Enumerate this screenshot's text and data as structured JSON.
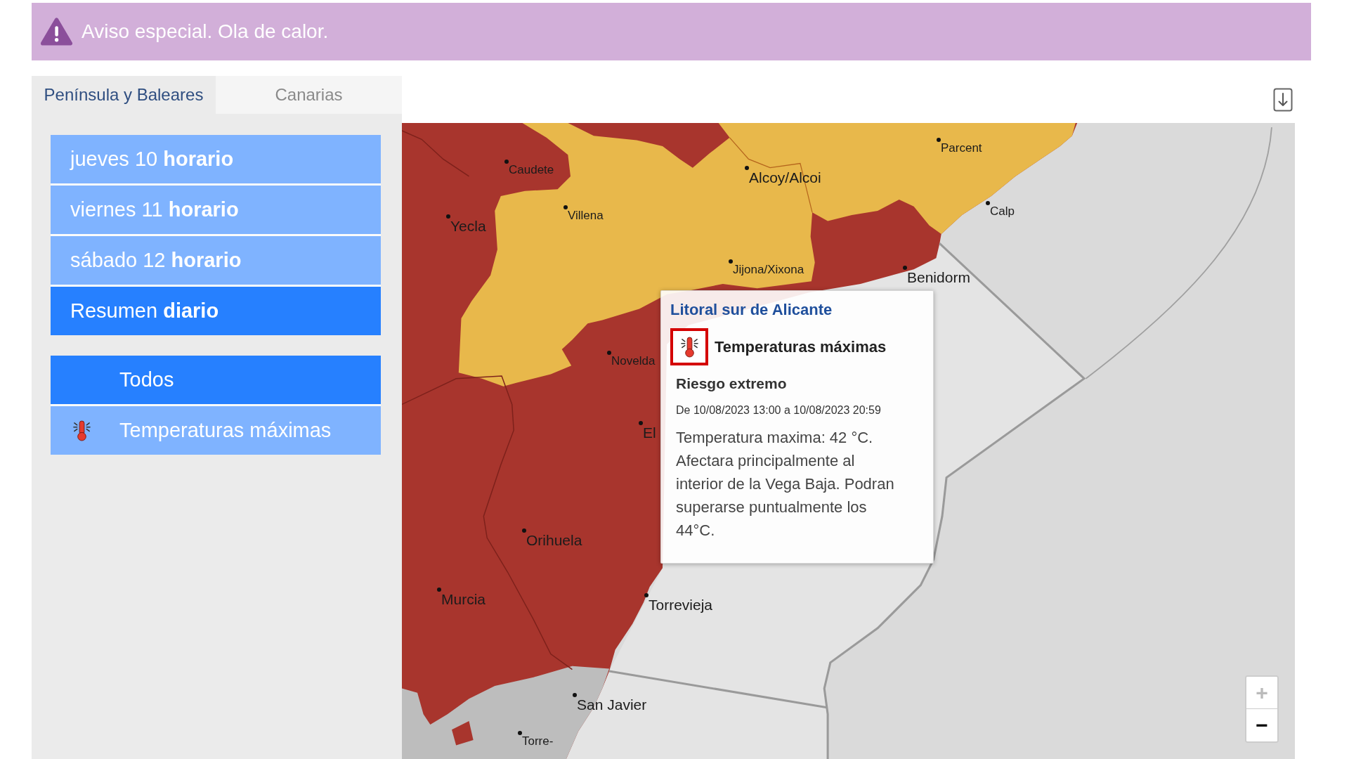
{
  "banner": {
    "text": "Aviso especial. Ola de calor."
  },
  "tabs": [
    {
      "label": "Península y Baleares",
      "selected": true
    },
    {
      "label": "Canarias",
      "selected": false
    }
  ],
  "days": [
    {
      "label": "jueves 10 **horario**",
      "selected": false
    },
    {
      "label": "viernes 11 **horario**",
      "selected": false
    },
    {
      "label": "sábado 12 **horario**",
      "selected": false
    },
    {
      "label": "Resumen **diario**",
      "selected": true
    }
  ],
  "phenomena": [
    {
      "label": "Todos",
      "kind": "all",
      "selected": true
    },
    {
      "label": "Temperaturas máximas",
      "kind": "temperature",
      "selected": false
    }
  ],
  "map": {
    "places": [
      {
        "name": "Parcent",
        "kind": "minor"
      },
      {
        "name": "Caudete",
        "kind": "minor"
      },
      {
        "name": "Alcoy/Alcoi",
        "kind": "major"
      },
      {
        "name": "Calp",
        "kind": "minor"
      },
      {
        "name": "Villena",
        "kind": "minor"
      },
      {
        "name": "Yecla",
        "kind": "major"
      },
      {
        "name": "Jijona/Xixona",
        "kind": "minor"
      },
      {
        "name": "Benidorm",
        "kind": "major"
      },
      {
        "name": "Novelda",
        "kind": "minor"
      },
      {
        "name": "El",
        "kind": "major"
      },
      {
        "name": "Orihuela",
        "kind": "major"
      },
      {
        "name": "Murcia",
        "kind": "major"
      },
      {
        "name": "Torrevieja",
        "kind": "major"
      },
      {
        "name": "San Javier",
        "kind": "major"
      },
      {
        "name": "Torre-",
        "kind": "minor"
      }
    ],
    "popup": {
      "title": "Litoral sur de Alicante",
      "phenomenon": "Temperaturas máximas",
      "risk": "Riesgo extremo",
      "period": "De 10/08/2023 13:00 a 10/08/2023 20:59",
      "description": "Temperatura maxima: 42 °C. Afectara principalmente al interior de la Vega Baja. Podran superarse puntualmente los 44°C."
    },
    "zoom": [
      {
        "label": "+",
        "disabled": true
      },
      {
        "label": "−",
        "disabled": false
      }
    ]
  }
}
